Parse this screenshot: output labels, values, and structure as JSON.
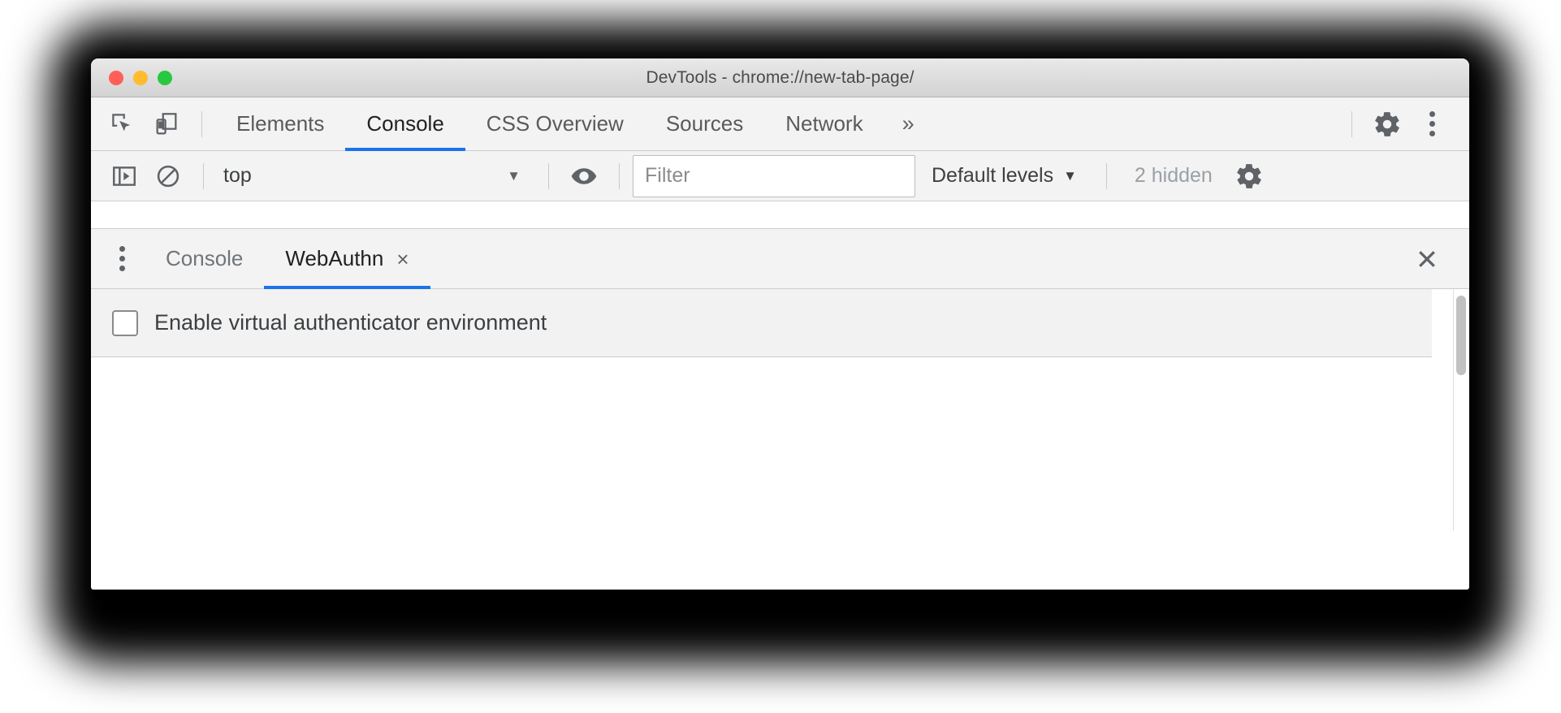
{
  "window": {
    "title": "DevTools - chrome://new-tab-page/",
    "traffic_lights": {
      "close_label": "close",
      "minimize_label": "minimize",
      "zoom_label": "zoom"
    }
  },
  "panel_toolbar": {
    "inspect_icon": "inspect-element-icon",
    "device_toolbar_icon": "device-toolbar-icon",
    "tabs": [
      {
        "label": "Elements",
        "active": false
      },
      {
        "label": "Console",
        "active": true
      },
      {
        "label": "CSS Overview",
        "active": false
      },
      {
        "label": "Sources",
        "active": false
      },
      {
        "label": "Network",
        "active": false
      }
    ],
    "overflow_label": "»",
    "settings_icon": "gear-icon",
    "more_icon": "kebab-menu-icon",
    "accent_color": "#1a73e8"
  },
  "console_toolbar": {
    "sidebar_toggle_icon": "console-sidebar-icon",
    "clear_console_icon": "clear-console-icon",
    "context_value": "top",
    "context_caret": "▼",
    "live_expression_icon": "eye-icon",
    "filter_placeholder": "Filter",
    "filter_value": "",
    "levels_label": "Default levels",
    "levels_caret": "▼",
    "hidden_text": "2 hidden",
    "settings_icon": "gear-icon"
  },
  "drawer": {
    "menu_icon": "kebab-menu-icon",
    "tabs": [
      {
        "label": "Console",
        "active": false,
        "closable": false
      },
      {
        "label": "WebAuthn",
        "active": true,
        "closable": true,
        "close_glyph": "×"
      }
    ],
    "close_glyph": "✕",
    "accent_color": "#1a73e8"
  },
  "webauthn": {
    "enable_label": "Enable virtual authenticator environment",
    "enable_checked": false
  }
}
